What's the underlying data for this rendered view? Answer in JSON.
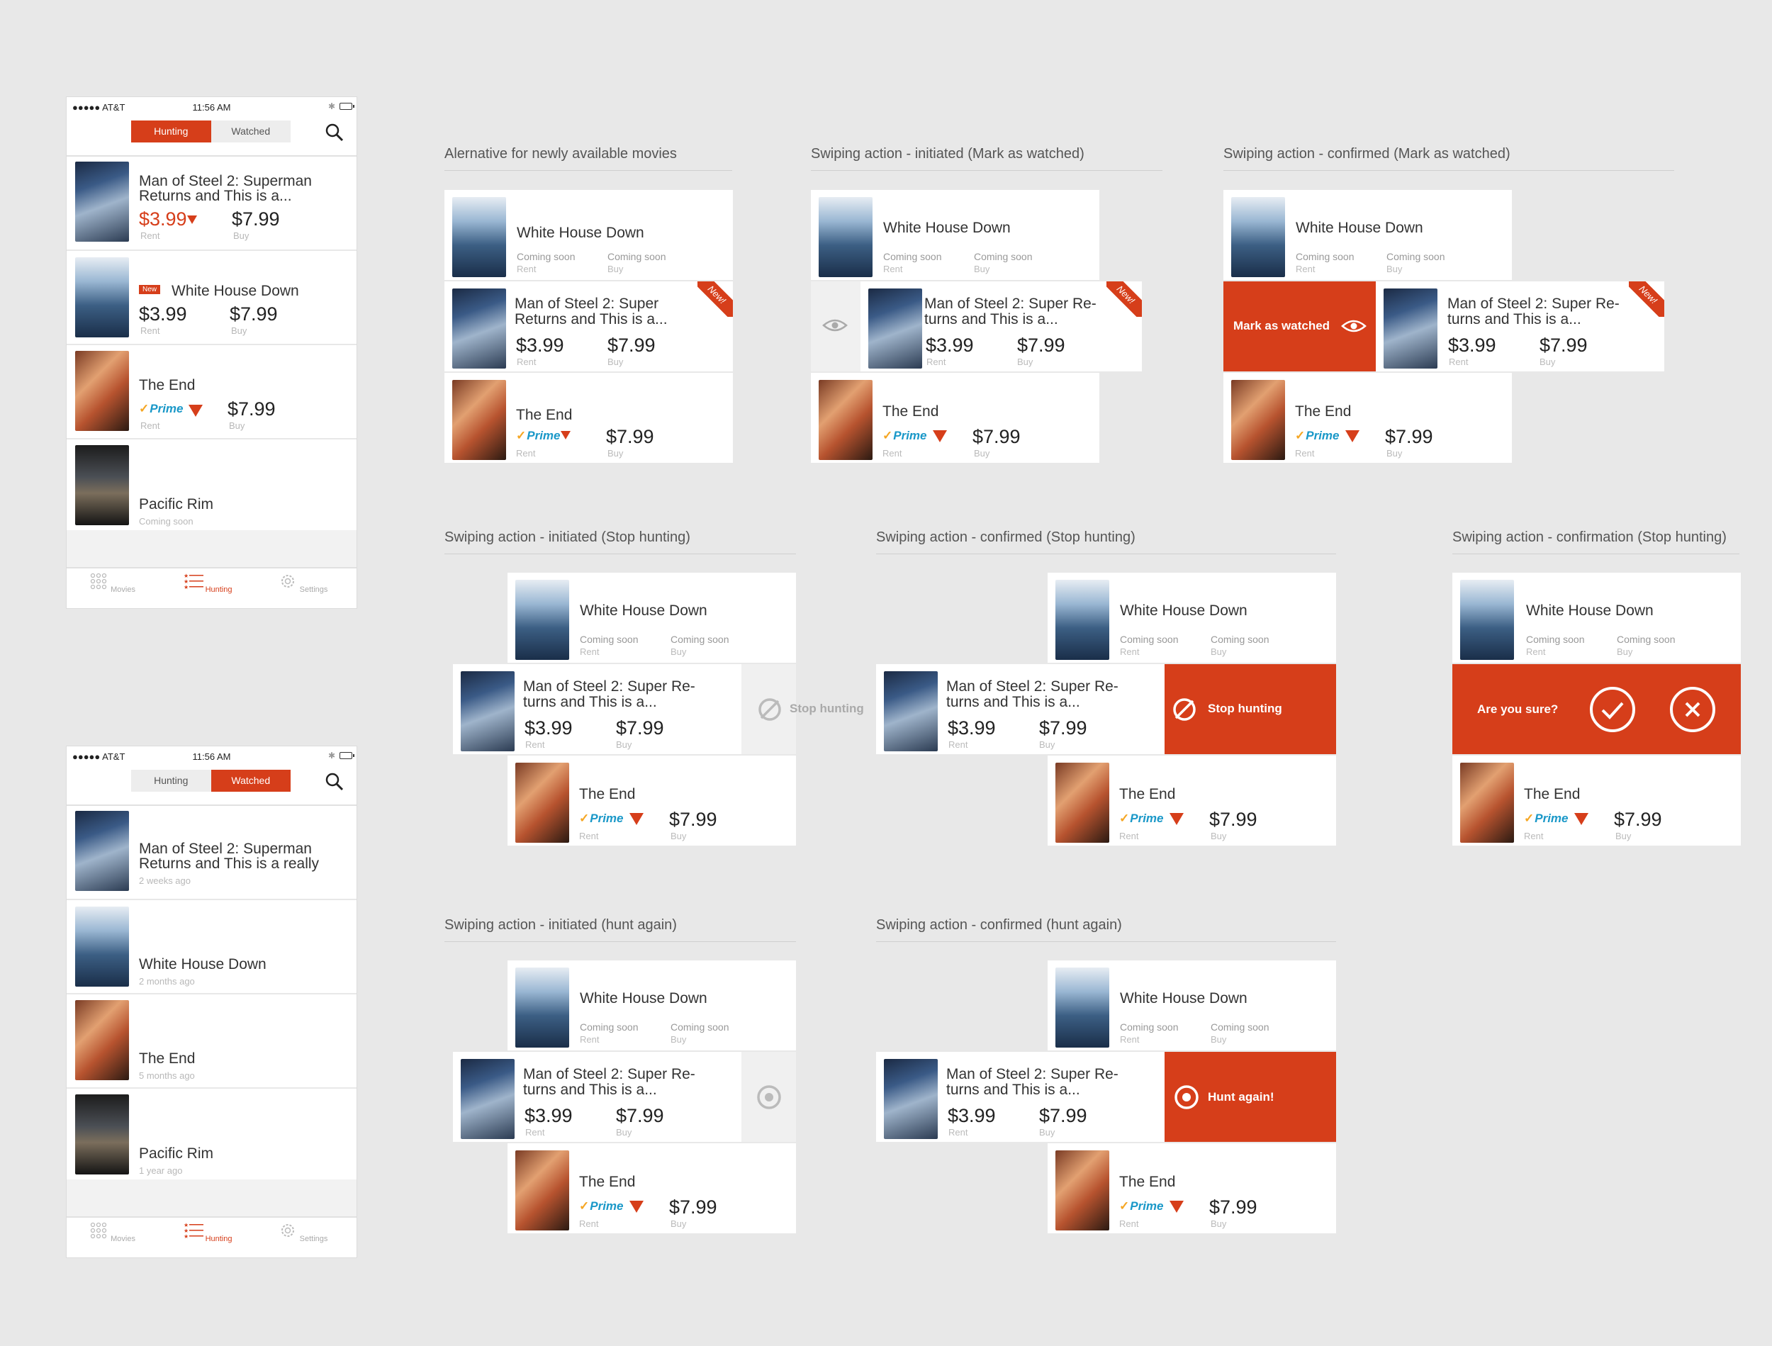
{
  "phones": {
    "hunting": {
      "status": {
        "carrier": "●●●●● AT&T",
        "time": "11:56 AM"
      },
      "seg": {
        "left": "Hunting",
        "right": "Watched"
      },
      "rows": [
        {
          "title1": "Man of Steel 2: Superman",
          "title2": "Returns and This is a...",
          "rent": "$3.99",
          "buy": "$7.99",
          "rent_label": "Rent",
          "buy_label": "Buy"
        },
        {
          "badge": "New",
          "title1": "White House Down",
          "rent": "$3.99",
          "buy": "$7.99",
          "rent_label": "Rent",
          "buy_label": "Buy"
        },
        {
          "title1": "The End",
          "prime": "Prime",
          "buy": "$7.99",
          "rent_label": "Rent",
          "buy_label": "Buy"
        },
        {
          "title1": "Pacific Rim",
          "sub": "Coming soon"
        }
      ],
      "tabs": [
        "Movies",
        "Hunting",
        "Settings"
      ]
    },
    "watched": {
      "status": {
        "carrier": "●●●●● AT&T",
        "time": "11:56 AM"
      },
      "seg": {
        "left": "Hunting",
        "right": "Watched"
      },
      "rows": [
        {
          "title1": "Man of Steel 2: Superman",
          "title2": "Returns and This is a really",
          "sub": "2 weeks ago"
        },
        {
          "title1": "White House Down",
          "sub": "2 months ago"
        },
        {
          "title1": "The End",
          "sub": "5 months ago"
        },
        {
          "title1": "Pacific Rim",
          "sub": "1 year ago"
        }
      ],
      "tabs": [
        "Movies",
        "Hunting",
        "Settings"
      ]
    }
  },
  "sections": {
    "s1": "Alernative for newly available movies",
    "s2": "Swiping action - initiated (Mark as watched)",
    "s3": "Swiping action - confirmed (Mark as watched)",
    "s4": "Swiping action - initiated (Stop hunting)",
    "s5": "Swiping action - confirmed (Stop hunting)",
    "s6": "Swiping action - confirmation (Stop hunting)",
    "s7": "Swiping action - initiated (hunt again)",
    "s8": "Swiping action - confirmed (hunt again)"
  },
  "movie": {
    "whd": "White House Down",
    "ms_a": "Man of Steel 2: Super",
    "ms_b": "Returns and This is a...",
    "ms_c": "Man of Steel 2: Super Re-",
    "ms_d": "turns and This is a...",
    "te": "The End",
    "soon": "Coming soon",
    "rent": "Rent",
    "buy": "Buy",
    "p399": "$3.99",
    "p799": "$7.99",
    "prime": "Prime",
    "new": "New!"
  },
  "actions": {
    "mark": "Mark as watched",
    "stop": "Stop hunting",
    "sure": "Are you sure?",
    "again": "Hunt again!"
  },
  "colors": {
    "accent": "#d63e1a",
    "prime": "#1a98c8"
  }
}
